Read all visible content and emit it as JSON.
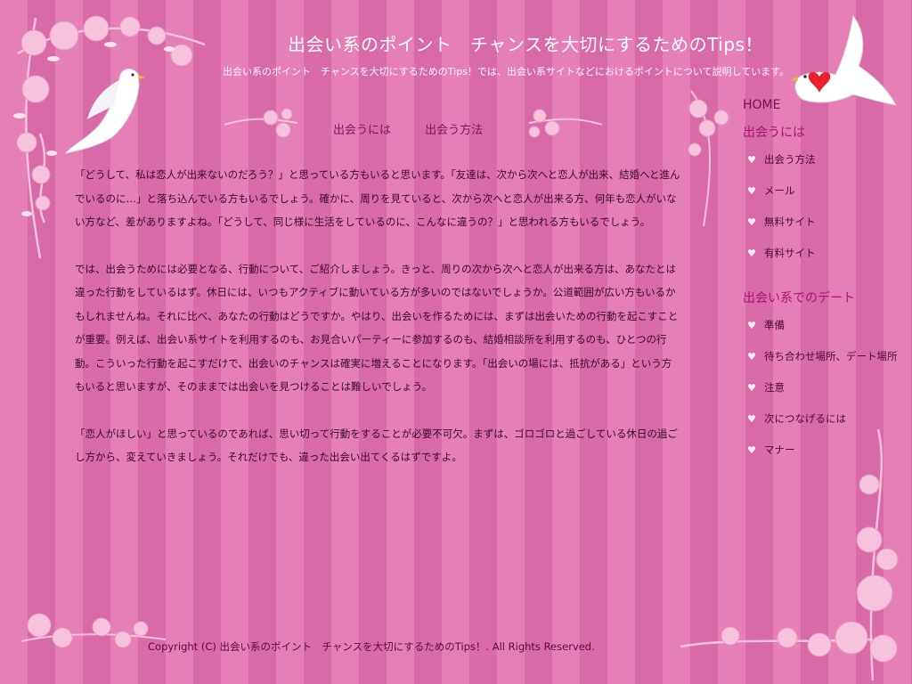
{
  "site": {
    "title": "出会い系のポイント　チャンスを大切にするためのTips！",
    "description": "出会い系のポイント　チャンスを大切にするためのTips！では、出会い系サイトなどにおけるポイントについて説明しています。"
  },
  "breadcrumbs": [
    "出会うには",
    "出会う方法"
  ],
  "content": {
    "paragraphs": [
      "「どうして、私は恋人が出来ないのだろう？」と思っている方もいると思います。「友達は、次から次へと恋人が出来、結婚へと進んでいるのに…」と落ち込んでいる方もいるでしょう。確かに、周りを見ていると、次から次へと恋人が出来る方、何年も恋人がいない方など、差がありますよね。「どうして、同じ様に生活をしているのに、こんなに違うの？」と思われる方もいるでしょう。",
      "では、出会うためには必要となる、行動について、ご紹介しましょう。きっと、周りの次から次へと恋人が出来る方は、あなたとは違った行動をしているはず。休日には、いつもアクティブに動いている方が多いのではないでしょうか。公道範囲が広い方もいるかもしれませんね。それに比べ、あなたの行動はどうですか。やはり、出会いを作るためには、まずは出会いための行動を起こすことが重要。例えば、出会い系サイトを利用するのも、お見合いパーティーに参加するのも、結婚相談所を利用するのも、ひとつの行動。こういった行動を起こすだけで、出会いのチャンスは確実に増えることになります。「出会いの場には、抵抗がある」という方もいると思いますが、そのままでは出会いを見つけることは難しいでしょう。",
      "「恋人がほしい」と思っているのであれば、思い切って行動をすることが必要不可欠。まずは、ゴロゴロと過ごしている休日の過ごし方から、変えていきましょう。それだけでも、違った出会い出てくるはずですよ。"
    ]
  },
  "sidebar": {
    "home": "HOME",
    "section1": {
      "heading": "出会うには",
      "items": [
        "出会う方法",
        "メール",
        "無料サイト",
        "有料サイト"
      ]
    },
    "section2": {
      "heading": "出会い系でのデート",
      "items": [
        "準備",
        "待ち合わせ場所、デート場所",
        "注意",
        "次につなげるには",
        "マナー"
      ]
    },
    "bullet_icon": "heart-icon"
  },
  "footer": {
    "copyright": "Copyright (C)  出会い系のポイント　チャンスを大切にするためのTips！.  All Rights Reserved."
  },
  "colors": {
    "stripe_light": "#e67fb6",
    "stripe_dark": "#d96aa8",
    "rose": "#f9c7df",
    "heading_text": "#a8137a",
    "body_text": "#3a0a26",
    "heart_red": "#e8202a"
  }
}
